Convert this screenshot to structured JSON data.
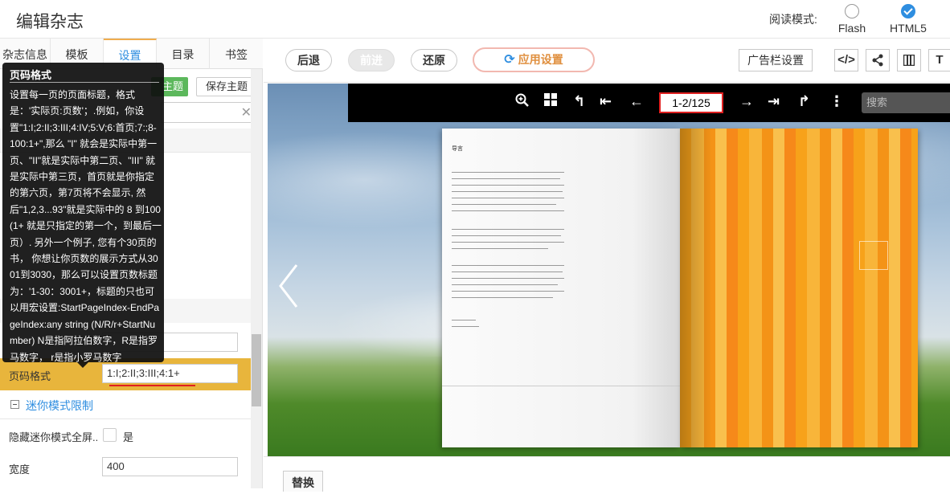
{
  "header": {
    "title": "编辑杂志",
    "read_mode_label": "阅读模式:",
    "modes": [
      {
        "label": "Flash",
        "checked": false
      },
      {
        "label": "HTML5",
        "checked": true
      }
    ]
  },
  "left_panel": {
    "tabs": [
      "杂志信息",
      "模板",
      "设置",
      "目录",
      "书签"
    ],
    "active_tab": "设置",
    "theme_button_partial": "主题",
    "save_theme_button": "保存主题",
    "page_format": {
      "label": "页码格式",
      "value": "1:I;2:II;3:III;4:1+"
    },
    "mini_mode": {
      "section_title": "迷你模式限制",
      "hide_fullscreen_label": "隐藏迷你模式全屏...",
      "hide_fullscreen_option": "是",
      "width_label": "宽度",
      "width_value": "400"
    }
  },
  "tooltip": {
    "title": "页码格式",
    "body": "设置每一页的页面标题，格式是：'实际页:页数'；.例如，你设置\"1:I;2:II;3:III;4:IV;5:V;6:首页;7:;8-100:1+\",那么 \"I\" 就会是实际中第一页、\"II\"就是实际中第二页、\"III\" 就是实际中第三页，首页就是你指定的第六页，第7页将不会显示, 然后\"1,2,3...93\"就是实际中的 8 到100 (1+ 就是只指定的第一个，到最后一页）. 另外一个例子, 您有个30页的书， 你想让你页数的展示方式从3001到3030，那么可以设置页数标题为：'1-30：3001+，标题的只也可以用宏设置:StartPageIndex-EndPageIndex:any string (N/R/r+StartNumber) N是指阿拉伯数字，R是指罗马数字， r是指小罗马数字"
  },
  "toolbar": {
    "back": "后退",
    "forward": "前进",
    "restore": "还原",
    "apply": "应用设置",
    "ad_settings": "广告栏设置",
    "icons": [
      "code-icon",
      "share-icon",
      "columns-icon",
      "text-icon"
    ]
  },
  "preview": {
    "page_counter": "1-2/125",
    "search_placeholder": "搜索",
    "page_left_heading": "导言"
  },
  "bottom": {
    "replace_button": "替换"
  },
  "colors": {
    "accent_blue": "#2f8ee0",
    "highlight_row": "#e8b53c",
    "green_button": "#5cb85c",
    "counter_border": "#e02020"
  }
}
